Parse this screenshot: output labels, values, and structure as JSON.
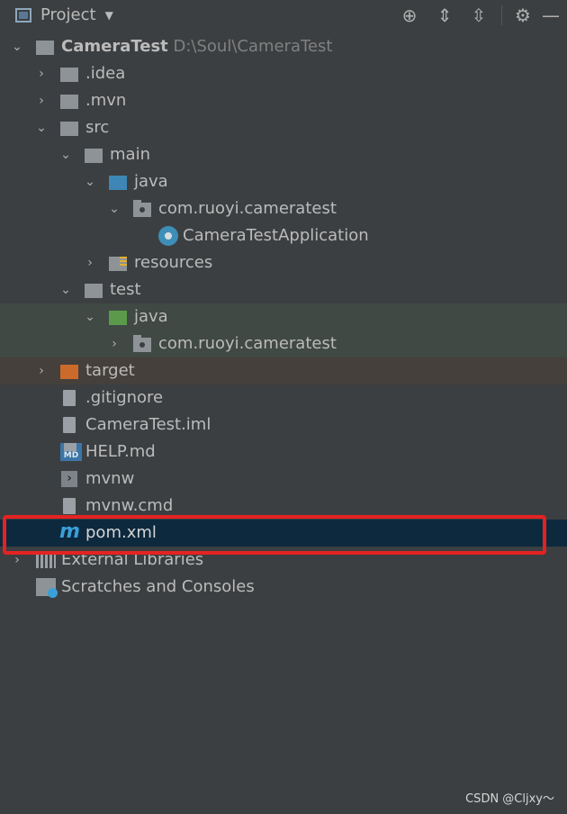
{
  "header": {
    "title": "Project",
    "icons": [
      "locate-icon",
      "expand-all-icon",
      "collapse-all-icon",
      "gear-icon",
      "minimize-icon"
    ]
  },
  "tree": {
    "root": {
      "name": "CameraTest",
      "path": "D:\\Soul\\CameraTest"
    },
    "idea": ".idea",
    "mvn": ".mvn",
    "src": "src",
    "main": "main",
    "main_java": "java",
    "main_pkg": "com.ruoyi.cameratest",
    "app_class": "CameraTestApplication",
    "resources": "resources",
    "test": "test",
    "test_java": "java",
    "test_pkg": "com.ruoyi.cameratest",
    "target": "target",
    "gitignore": ".gitignore",
    "iml": "CameraTest.iml",
    "help": "HELP.md",
    "help_badge": "MD",
    "mvnw": "mvnw",
    "mvnw_cmd": "mvnw.cmd",
    "pom": "pom.xml",
    "m_glyph": "m",
    "ext_libs": "External Libraries",
    "scratches": "Scratches and Consoles"
  },
  "colors": {
    "highlight_box": "#e52222",
    "selected_row": "#0d293e",
    "test_row": "#404944",
    "target_row": "#45403b"
  },
  "watermark": "CSDN @Cljxy～"
}
